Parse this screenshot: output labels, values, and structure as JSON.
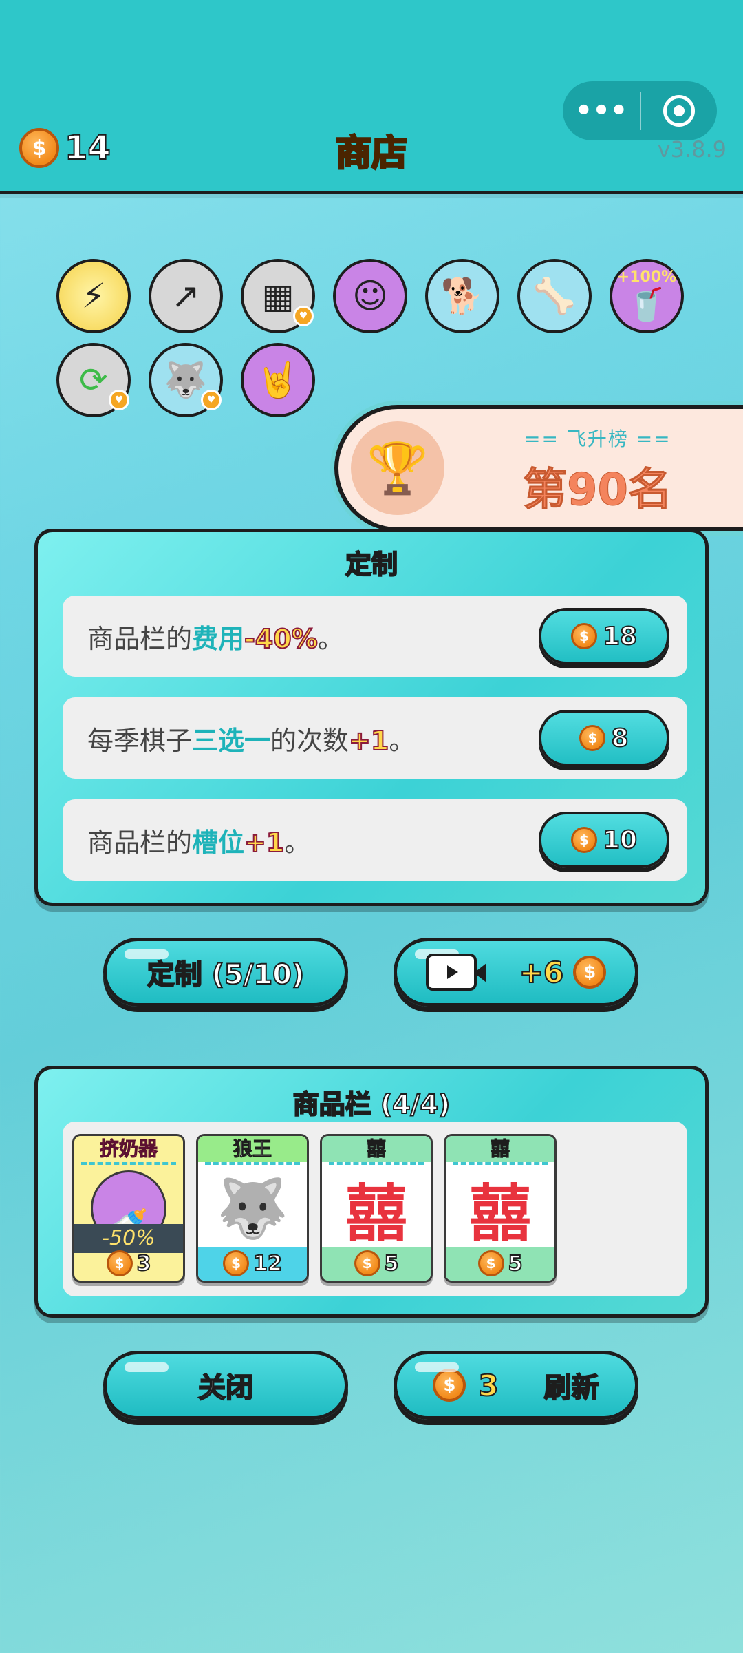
{
  "header": {
    "coins": "14",
    "title": "商店",
    "version": "v3.8.9",
    "capsule_menu": "•••"
  },
  "icons_row1": [
    "lightning-icon",
    "arrow-up-icon",
    "boxes-icon",
    "math-face-icon",
    "dog-icon",
    "bone-bowl-icon",
    "milk-tea-icon"
  ],
  "icons_row2": [
    "refresh-icon",
    "husky-icon",
    "rock-hand-icon"
  ],
  "milk_tea_label": "+100%",
  "rank": {
    "subtitle": "== 飞升榜 ==",
    "value": "第90名"
  },
  "custom_panel": {
    "title": "定制",
    "rows": [
      {
        "pre": "商品栏的",
        "hl1": "费用",
        "hl2": "-40%",
        "post": "。",
        "price": "18"
      },
      {
        "pre": "每季棋子",
        "hl1": "三选一",
        "mid": "的次数",
        "hl2": "+1",
        "post": "。",
        "price": "8"
      },
      {
        "pre": "商品栏的",
        "hl1": "槽位",
        "hl2": "+1",
        "post": "。",
        "price": "10"
      }
    ]
  },
  "buttons": {
    "custom_label": "定制 (5/10)",
    "video_reward": "+6",
    "close_label": "关闭",
    "refresh_cost": "3",
    "refresh_label": "刷新"
  },
  "shop_panel": {
    "title": "商品栏 (4/4)",
    "cards": [
      {
        "name": "挤奶器",
        "discount": "-50%",
        "price": "3"
      },
      {
        "name": "狼王",
        "price": "12"
      },
      {
        "name": "囍",
        "glyph": "囍",
        "price": "5"
      },
      {
        "name": "囍",
        "glyph": "囍",
        "price": "5"
      }
    ]
  },
  "coin_glyph": "$"
}
